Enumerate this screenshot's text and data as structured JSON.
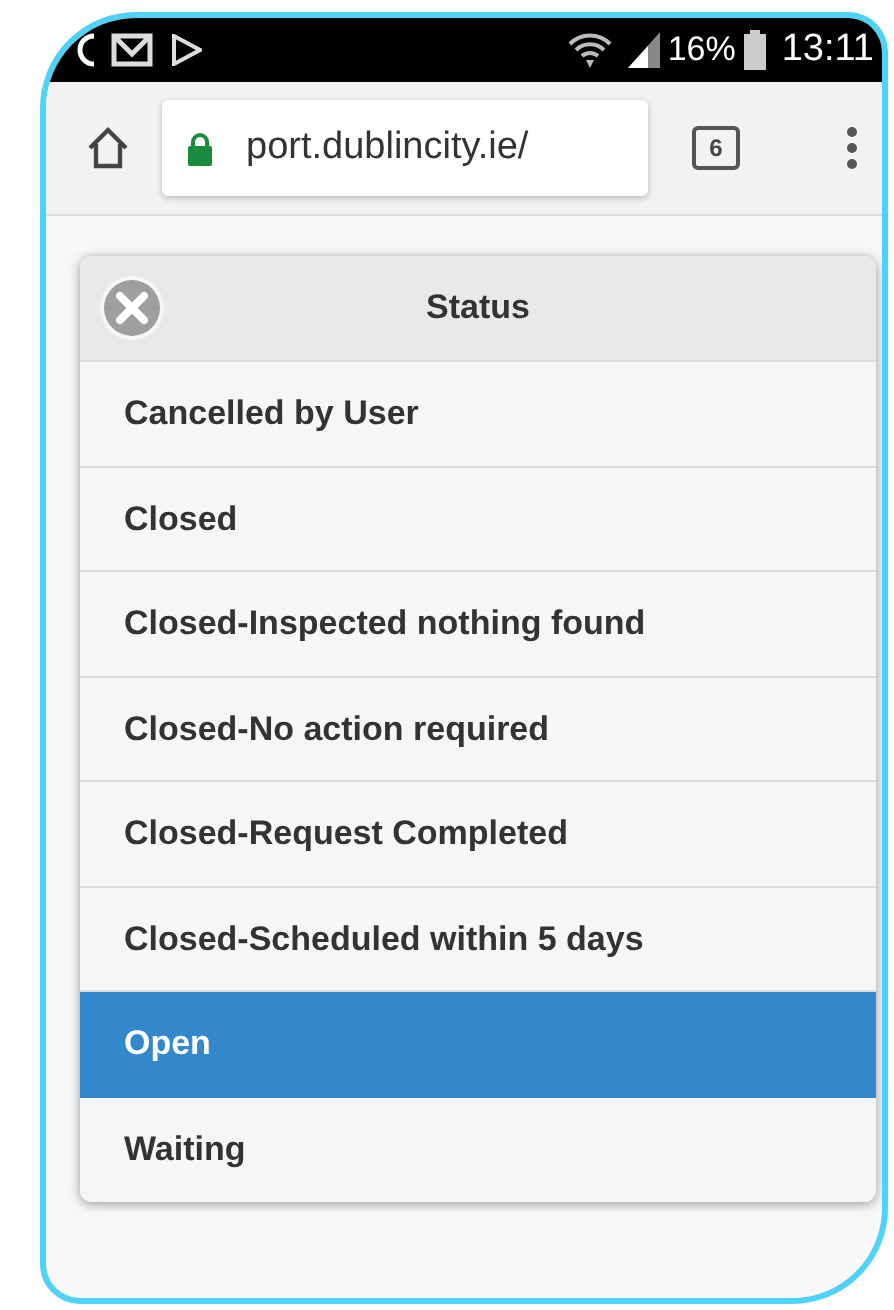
{
  "status_bar": {
    "battery": "16%",
    "time": "13:11"
  },
  "browser": {
    "url": "port.dublincity.ie/",
    "tab_count": "6"
  },
  "dialog": {
    "title": "Status",
    "items": [
      {
        "label": "Cancelled by User",
        "selected": false
      },
      {
        "label": "Closed",
        "selected": false
      },
      {
        "label": "Closed-Inspected nothing found",
        "selected": false
      },
      {
        "label": "Closed-No action required",
        "selected": false
      },
      {
        "label": "Closed-Request Completed",
        "selected": false
      },
      {
        "label": "Closed-Scheduled within 5 days",
        "selected": false
      },
      {
        "label": "Open",
        "selected": true
      },
      {
        "label": "Waiting",
        "selected": false
      }
    ]
  }
}
